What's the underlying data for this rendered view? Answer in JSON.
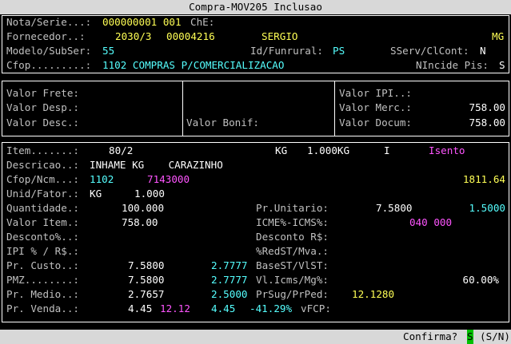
{
  "window": {
    "title": "Compra-MOV205  Inclusao"
  },
  "header": {
    "nota_label": "Nota/Serie...:",
    "nota_value": "000000001 001",
    "che_label": "ChE:",
    "fornecedor_label": "Fornecedor..:",
    "fornecedor_code": "2030/3",
    "fornecedor_num": "00004216",
    "fornecedor_name": "SERGIO",
    "fornecedor_uf": "MG",
    "modelo_label": "Modelo/SubSer:",
    "modelo_value": "55",
    "funrural_label": "Id/Funrural:",
    "funrural_value": "PS",
    "sserv_label": "SServ/ClCont:",
    "sserv_value": "N",
    "cfop_label": "Cfop.........:",
    "cfop_value": "1102 COMPRAS P/COMERCIALIZACAO",
    "nincide_label": "NIncide Pis:",
    "nincide_value": "S"
  },
  "totals": {
    "frete_label": "Valor Frete:",
    "desp_label": "Valor Desp.:",
    "desc_label": "Valor Desc.:",
    "bonif_label": "Valor Bonif:",
    "ipi_label": "Valor IPI..:",
    "merc_label": "Valor Merc.:",
    "merc_value": "758.00",
    "docum_label": "Valor Docum:",
    "docum_value": "758.00"
  },
  "item": {
    "item_label": "Item.......:",
    "item_value": "80/2",
    "kg_label": "KG",
    "kg_value": "1.000KG",
    "i_label": "I",
    "isento": "Isento",
    "descricao_label": "Descricao..:",
    "descricao_value": "INHAME KG    CARAZINHO",
    "cfopncm_label": "Cfop/Ncm...:",
    "cfop_value": "1102",
    "ncm_value": "7143000",
    "ncm_total": "1811.64",
    "unid_label": "Unid/Fator.:",
    "unid_value": "KG",
    "fator_value": "1.000",
    "quantidade_label": "Quantidade.:",
    "quantidade_value": "100.000",
    "unitario_label": "Pr.Unitario:",
    "unitario_value": "7.5800",
    "unitario_value2": "1.5000",
    "valor_item_label": "Valor Item.:",
    "valor_item_value": "758.00",
    "icms_label": "ICME%-ICMS%:",
    "icms_value": "040 000",
    "desconto_label": "Desconto%..:",
    "desconto_rs_label": "Desconto R$:",
    "ipi_label": "IPI % / R$.:",
    "redst_label": "%RedST/Mva.:",
    "custo_label": "Pr. Custo..:",
    "custo_value": "7.5800",
    "custo_value2": "2.7777",
    "basest_label": "BaseST/VlST:",
    "pmz_label": "PMZ........:",
    "pmz_value": "7.5800",
    "pmz_value2": "2.7777",
    "vlicms_label": "Vl.Icms/Mg%:",
    "vlicms_value": "60.00%",
    "medio_label": "Pr. Medio..:",
    "medio_value": "2.7657",
    "medio_value2": "2.5000",
    "prsug_label": "PrSug/PrPed:",
    "prsug_value": "12.1280",
    "venda_label": "Pr. Venda..:",
    "venda_value": "4.45",
    "venda_value2": "12.12",
    "venda_value3": "4.45",
    "venda_pct": "-41.29%",
    "vfcp_label": "vFCP:"
  },
  "status": {
    "confirma_label": "Confirma?",
    "confirma_value": "S",
    "options": "(S/N)"
  }
}
